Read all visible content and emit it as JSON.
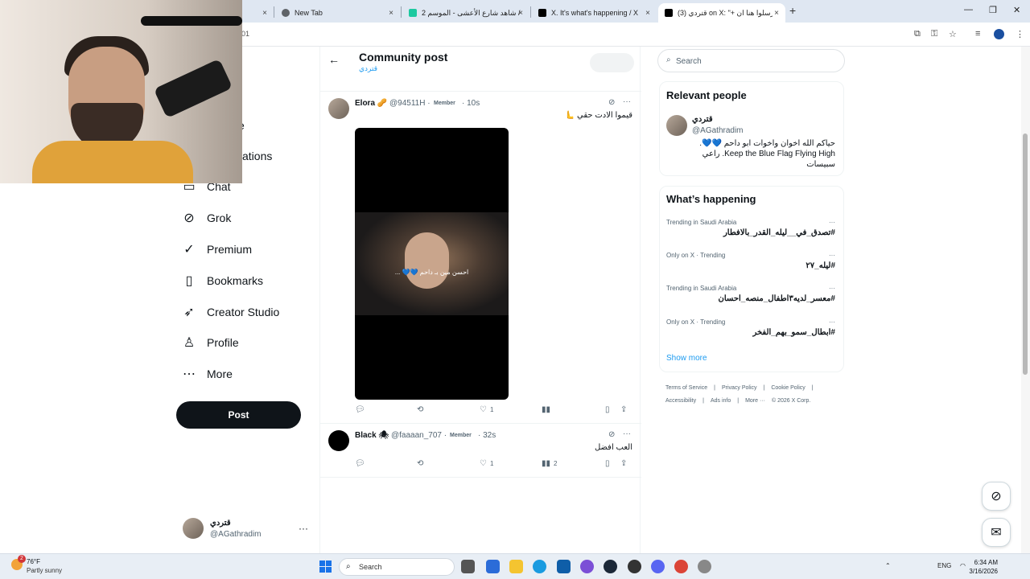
{
  "browser": {
    "tabs": [
      {
        "label": "",
        "close": "×"
      },
      {
        "label": "New Tab",
        "close": "×"
      },
      {
        "label": "شاهد شارع الأعشى - الموسم 2 /",
        "close": "×"
      },
      {
        "label": "X. It's what's happening / X",
        "close": "×"
      },
      {
        "label": "(3) قتردي on X: \"+ ارسلوا هنا ان...",
        "close": "×"
      }
    ],
    "new_tab": "+",
    "address_fragment": "01"
  },
  "nav": {
    "items": [
      {
        "label": "Chat",
        "icon": "chat-icon",
        "glyph": "▭"
      },
      {
        "label": "Grok",
        "icon": "grok-icon",
        "glyph": "⊘"
      },
      {
        "label": "Premium",
        "icon": "premium-icon",
        "glyph": "✓"
      },
      {
        "label": "Bookmarks",
        "icon": "bookmark-icon",
        "glyph": "▯"
      },
      {
        "label": "Creator Studio",
        "icon": "rocket-icon",
        "glyph": "➶"
      },
      {
        "label": "Profile",
        "icon": "person-icon",
        "glyph": "♙"
      },
      {
        "label": "More",
        "icon": "more-circle-icon",
        "glyph": "⋯"
      }
    ],
    "partial_labels": [
      "e",
      "ations"
    ],
    "post_label": "Post",
    "account": {
      "name": "قتردي",
      "handle": "@AGathradim",
      "more": "···"
    }
  },
  "main": {
    "title": "Community post",
    "subtitle": "قتردي",
    "tweets": [
      {
        "name": "Elora 🥜",
        "handle": "@94511H ·",
        "badge": "Member",
        "time": "· 10s",
        "text": "قيموا الادت حقي 🫷",
        "media_caption": "احسن مين بـ داحم 💙💙 ...",
        "actions": {
          "reply": "",
          "repost": "",
          "like": "1",
          "views": "",
          "bookmark": "",
          "share": ""
        }
      },
      {
        "name": "Black 🕷",
        "handle": "@faaaan_707 ·",
        "badge": "Member",
        "time": "· 32s",
        "text": "العب افضل",
        "actions": {
          "reply": "",
          "repost": "",
          "like": "1",
          "views": "2",
          "bookmark": "",
          "share": ""
        }
      }
    ]
  },
  "right": {
    "search_placeholder": "Search",
    "relevant_people": {
      "title": "Relevant people",
      "name": "قتردي",
      "handle": "@AGathradim",
      "bio": "حياكم الله اخوان واخوات ابو داحم 💙💙. Keep the Blue Flag Flying High. راعي سبيسات"
    },
    "whats_happening": {
      "title": "What’s happening",
      "trends": [
        {
          "context": "Trending in Saudi Arabia",
          "name": "#تصدق_في__ليله_القدر_بالافطار"
        },
        {
          "context": "Only on X · Trending",
          "name": "#ليله_٢٧"
        },
        {
          "context": "Trending in Saudi Arabia",
          "name": "#معسر_لديه٣اطفال_منصه_احسان"
        },
        {
          "context": "Only on X · Trending",
          "name": "#ابطال_سمو_بهم_الفخر"
        }
      ],
      "show_more": "Show more"
    },
    "footer": {
      "line1": [
        "Terms of Service",
        "|",
        "Privacy Policy",
        "|",
        "Cookie Policy",
        "|"
      ],
      "line2": [
        "Accessibility",
        "|",
        "Ads info",
        "|",
        "More ···",
        "© 2026 X Corp."
      ]
    }
  },
  "taskbar": {
    "weather_temp": "76°F",
    "weather_desc": "Partly sunny",
    "weather_badge": "2",
    "search_label": "Search",
    "lang": "ENG",
    "time": "6:34 AM",
    "date": "3/16/2026"
  },
  "colors": {
    "accent": "#1d9bf0",
    "text": "#0f1419",
    "muted": "#536471"
  }
}
